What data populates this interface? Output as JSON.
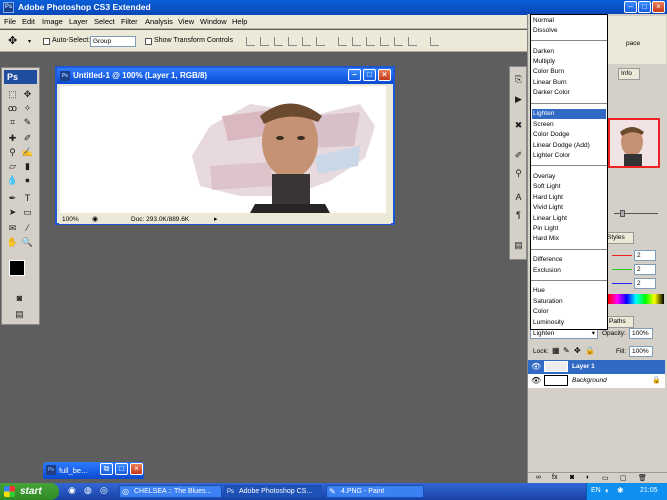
{
  "app": {
    "title": "Adobe Photoshop CS3 Extended",
    "ps_badge": "Ps"
  },
  "menu": [
    "File",
    "Edit",
    "Image",
    "Layer",
    "Select",
    "Filter",
    "Analysis",
    "View",
    "Window",
    "Help"
  ],
  "options": {
    "auto_select_label": "Auto-Select:",
    "auto_select_value": "Group",
    "show_transform_label": "Show Transform Controls",
    "workspace_label": "pace"
  },
  "toolbox": {
    "badge": "Ps"
  },
  "document": {
    "title": "Untitled-1 @ 100% (Layer 1, RGB/8)",
    "zoom": "100%",
    "doc_info": "Doc: 293.0K/889.6K"
  },
  "blend_modes": {
    "items": [
      "Normal",
      "Dissolve",
      "Darken",
      "Multiply",
      "Color Burn",
      "Linear Burn",
      "Darker Color",
      "Lighten",
      "Screen",
      "Color Dodge",
      "Linear Dodge (Add)",
      "Lighter Color",
      "Overlay",
      "Soft Light",
      "Hard Light",
      "Vivid Light",
      "Linear Light",
      "Pin Light",
      "Hard Mix",
      "Difference",
      "Exclusion",
      "Hue",
      "Saturation",
      "Color",
      "Luminosity"
    ],
    "selected": "Lighten"
  },
  "right_panel": {
    "info_tab": "Info",
    "styles_tab": "Styles",
    "paths_tab": "Paths",
    "color_values": [
      "2",
      "2",
      "2"
    ],
    "blend_value": "Lighten",
    "opacity_label": "Opacity:",
    "opacity_value": "100%",
    "lock_label": "Lock:",
    "fill_label": "Fill:",
    "fill_value": "100%",
    "layers": [
      "Layer 1",
      "Background"
    ]
  },
  "minimized": {
    "title": "full_be..."
  },
  "taskbar": {
    "start": "start",
    "items": [
      "CHELSEA :: The Blues...",
      "Adobe Photoshop CS...",
      "4.PNG - Paint"
    ],
    "lang": "EN",
    "time": "21:05"
  },
  "colors": {
    "xp_blue": "#0a5fd8",
    "selection": "#316ac5",
    "layer_selected": "#316ac5"
  }
}
